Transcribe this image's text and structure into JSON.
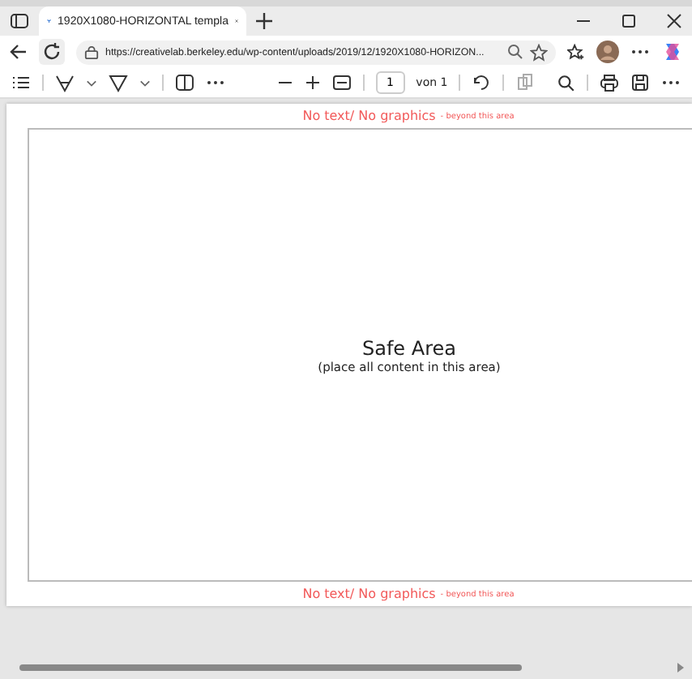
{
  "tab": {
    "title": "1920X1080-HORIZONTAL templa",
    "selected": true
  },
  "address": {
    "url": "https://creativelab.berkeley.edu/wp-content/uploads/2019/12/1920X1080-HORIZON..."
  },
  "pdf_toolbar": {
    "page_number": "1",
    "page_count": "von 1"
  },
  "page": {
    "top_label": {
      "text": "No text/ No graphics",
      "note": "- beyond this area"
    },
    "safe_area": {
      "title": "Safe Area",
      "subtitle": "(place all content in this area)"
    },
    "bottom_label": {
      "text": "No text/ No graphics",
      "note": "- beyond this area"
    }
  }
}
